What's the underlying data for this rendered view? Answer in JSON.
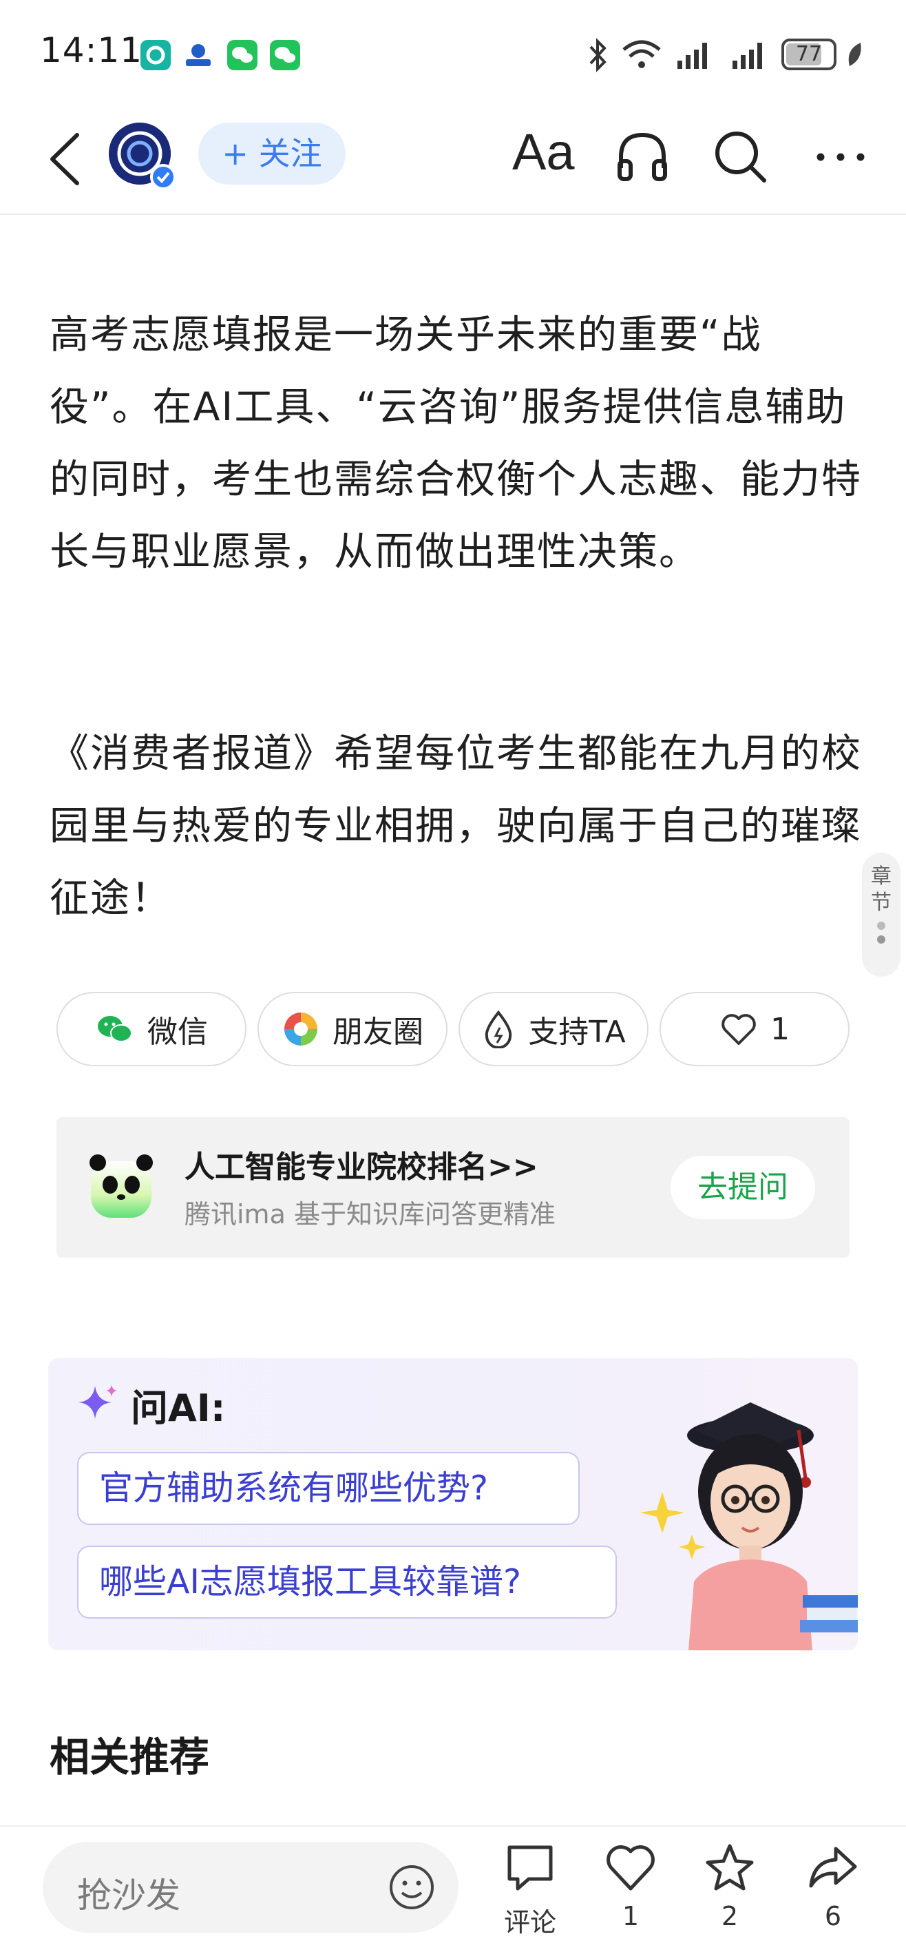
{
  "status_bar": {
    "time": "14:11",
    "battery": "77",
    "battery_fraction": 0.77
  },
  "nav": {
    "follow_label": "+ 关注",
    "font_label": "Aa"
  },
  "article": {
    "p1": "高考志愿填报是一场关乎未来的重要“战役”。在AI工具、“云咨询”服务提供信息辅助的同时，考生也需综合权衡个人志趣、能力特长与职业愿景，从而做出理性决策。",
    "p2": "《消费者报道》希望每位考生都能在九月的校园里与热爱的专业相拥，驶向属于自己的璀璨征途！"
  },
  "chapter_tab": {
    "label_1": "章",
    "label_2": "节"
  },
  "share": {
    "wechat": "微信",
    "moments": "朋友圈",
    "support": "支持TA",
    "likes": "1"
  },
  "ima": {
    "title": "人工智能专业院校排名>>",
    "subtitle": "腾讯ima 基于知识库问答更精准",
    "button": "去提问"
  },
  "ask_ai": {
    "title": "问AI:",
    "questions": [
      "官方辅助系统有哪些优势?",
      "哪些AI志愿填报工具较靠谱?"
    ]
  },
  "related": {
    "title": "相关推荐"
  },
  "bottom": {
    "placeholder": "抢沙发",
    "comment_label": "评论",
    "like_count": "1",
    "fav_count": "2",
    "share_count": "6"
  },
  "colors": {
    "accent_blue": "#3a7bf0",
    "ima_green": "#1aa34a",
    "ai_question": "#3b3fd0"
  }
}
